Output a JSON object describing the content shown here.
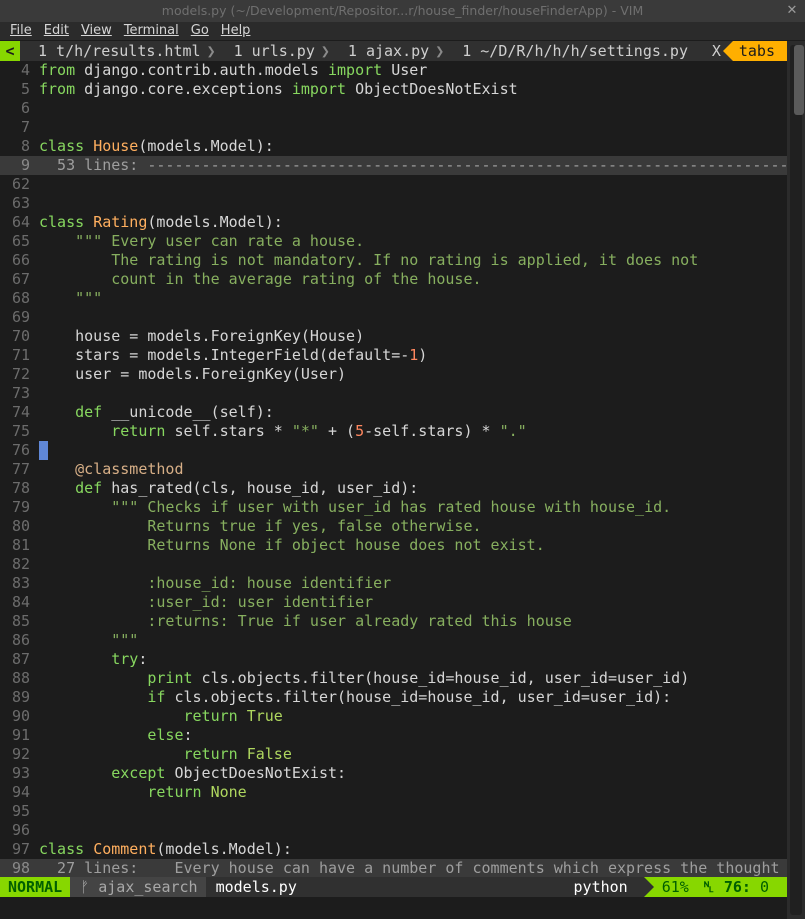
{
  "window": {
    "title": "models.py (~/Development/Repositor...r/house_finder/houseFinderApp) - VIM"
  },
  "menu": [
    "File",
    "Edit",
    "View",
    "Terminal",
    "Go",
    "Help"
  ],
  "tabline": {
    "left": "<",
    "tabs": [
      "1 t/h/results.html",
      "1 urls.py",
      "1 ajax.py",
      "1 ~/D/R/h/h/h/settings.py"
    ],
    "sep": "❯",
    "close": "X",
    "tabs_label": "tabs"
  },
  "status": {
    "mode": "NORMAL",
    "branch": "ajax_search",
    "branch_icon": "git-branch-icon",
    "filename": "models.py",
    "filetype": "python",
    "percent": "61%",
    "line": "76:",
    "col": "0"
  },
  "code": [
    {
      "n": "4",
      "t": "from django.contrib.auth.models import User"
    },
    {
      "n": "5",
      "t": "from django.core.exceptions import ObjectDoesNotExist"
    },
    {
      "n": "6",
      "t": ""
    },
    {
      "n": "7",
      "t": ""
    },
    {
      "n": "8",
      "t": "class House(models.Model):"
    },
    {
      "n": "9",
      "t": "  53 lines: ---------------------------------------------------------------------------",
      "fold": true
    },
    {
      "n": "62",
      "t": ""
    },
    {
      "n": "63",
      "t": ""
    },
    {
      "n": "64",
      "t": "class Rating(models.Model):"
    },
    {
      "n": "65",
      "t": "    \"\"\" Every user can rate a house."
    },
    {
      "n": "66",
      "t": "        The rating is not mandatory. If no rating is applied, it does not"
    },
    {
      "n": "67",
      "t": "        count in the average rating of the house."
    },
    {
      "n": "68",
      "t": "    \"\"\""
    },
    {
      "n": "69",
      "t": ""
    },
    {
      "n": "70",
      "t": "    house = models.ForeignKey(House)"
    },
    {
      "n": "71",
      "t": "    stars = models.IntegerField(default=-1)"
    },
    {
      "n": "72",
      "t": "    user = models.ForeignKey(User)"
    },
    {
      "n": "73",
      "t": ""
    },
    {
      "n": "74",
      "t": "    def __unicode__(self):"
    },
    {
      "n": "75",
      "t": "        return self.stars * \"*\" + (5-self.stars) * \".\""
    },
    {
      "n": "76",
      "t": "",
      "cursor": true
    },
    {
      "n": "77",
      "t": "    @classmethod"
    },
    {
      "n": "78",
      "t": "    def has_rated(cls, house_id, user_id):"
    },
    {
      "n": "79",
      "t": "        \"\"\" Checks if user with user_id has rated house with house_id."
    },
    {
      "n": "80",
      "t": "            Returns true if yes, false otherwise."
    },
    {
      "n": "81",
      "t": "            Returns None if object house does not exist."
    },
    {
      "n": "82",
      "t": ""
    },
    {
      "n": "83",
      "t": "            :house_id: house identifier"
    },
    {
      "n": "84",
      "t": "            :user_id: user identifier"
    },
    {
      "n": "85",
      "t": "            :returns: True if user already rated this house"
    },
    {
      "n": "86",
      "t": "        \"\"\""
    },
    {
      "n": "87",
      "t": "        try:"
    },
    {
      "n": "88",
      "t": "            print cls.objects.filter(house_id=house_id, user_id=user_id)"
    },
    {
      "n": "89",
      "t": "            if cls.objects.filter(house_id=house_id, user_id=user_id):"
    },
    {
      "n": "90",
      "t": "                return True"
    },
    {
      "n": "91",
      "t": "            else:"
    },
    {
      "n": "92",
      "t": "                return False"
    },
    {
      "n": "93",
      "t": "        except ObjectDoesNotExist:"
    },
    {
      "n": "94",
      "t": "            return None"
    },
    {
      "n": "95",
      "t": ""
    },
    {
      "n": "96",
      "t": ""
    },
    {
      "n": "97",
      "t": "class Comment(models.Model):"
    },
    {
      "n": "98",
      "t": "  27 lines:    Every house can have a number of comments which express the thought",
      "fold": true
    }
  ]
}
